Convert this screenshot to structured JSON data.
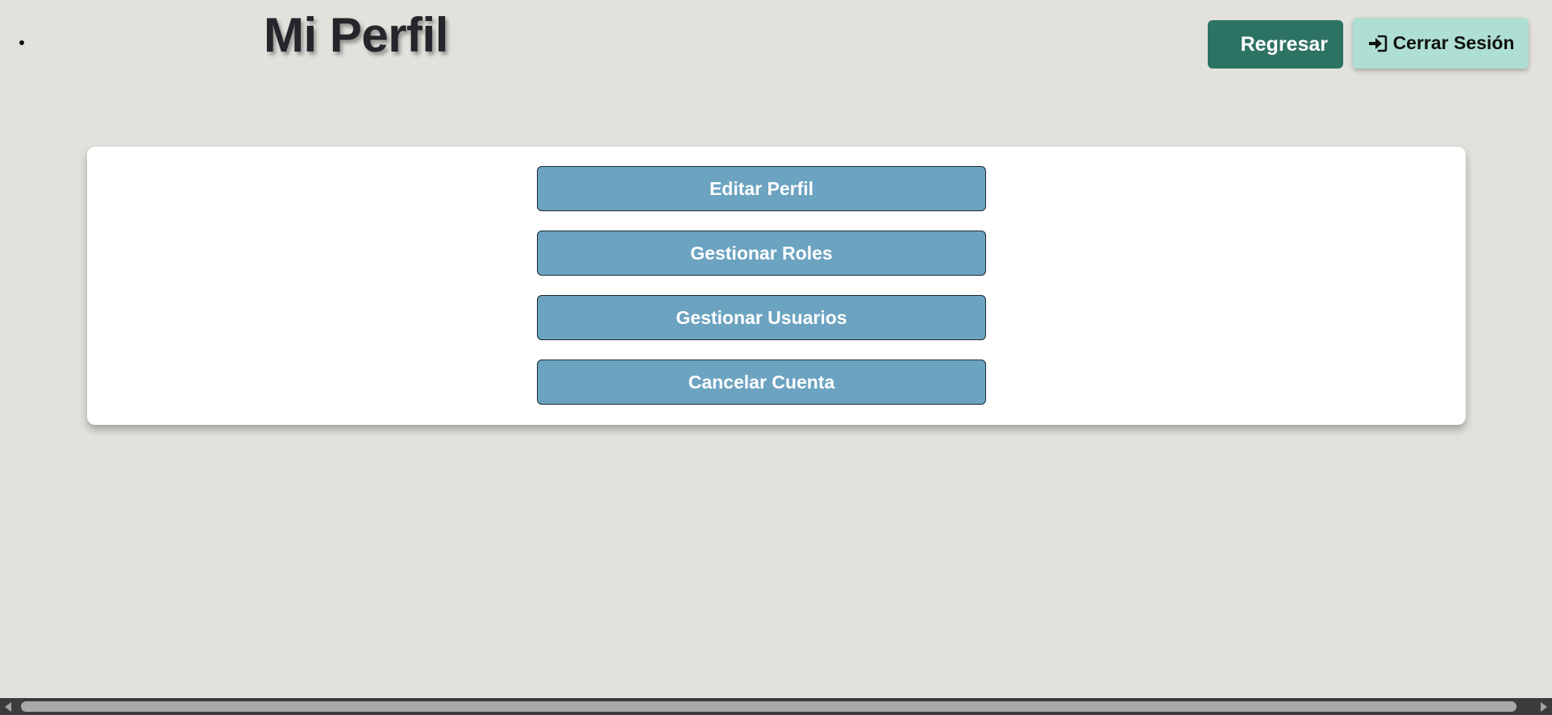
{
  "header": {
    "title": "Mi Perfil",
    "back_label": "Regresar",
    "logout_label": "Cerrar Sesión",
    "logout_icon": "sign-in-arrow-icon"
  },
  "menu": {
    "items": [
      {
        "label": "Editar Perfil"
      },
      {
        "label": "Gestionar Roles"
      },
      {
        "label": "Gestionar Usuarios"
      },
      {
        "label": "Cancelar Cuenta"
      }
    ]
  },
  "colors": {
    "background": "#e2e1dc",
    "back_button": "#2d7363",
    "logout_button": "#aedfd2",
    "menu_button": "#6ca3c1",
    "card": "#ffffff"
  }
}
